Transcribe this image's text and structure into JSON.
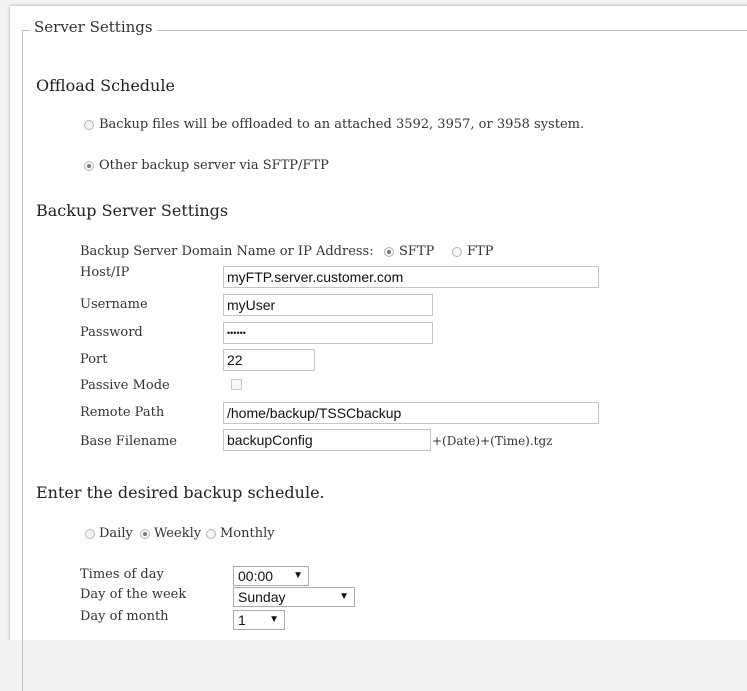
{
  "section_legend": "Server Settings",
  "offload": {
    "title": "Offload Schedule",
    "option_attached": "Backup files will be offloaded to an attached 3592, 3957, or 3958 system.",
    "option_other": "Other backup server via SFTP/FTP",
    "selected": "other"
  },
  "backup_server": {
    "title": "Backup Server Settings",
    "domain_label": "Backup Server Domain Name or IP Address:",
    "protocol_sftp": "SFTP",
    "protocol_ftp": "FTP",
    "protocol_selected": "SFTP",
    "host_label": "Host/IP",
    "host_value": "myFTP.server.customer.com",
    "username_label": "Username",
    "username_value": "myUser",
    "password_label": "Password",
    "password_value": "••••••",
    "port_label": "Port",
    "port_value": "22",
    "passive_label": "Passive Mode",
    "passive_checked": false,
    "remote_path_label": "Remote Path",
    "remote_path_value": "/home/backup/TSSCbackup",
    "base_filename_label": "Base Filename",
    "base_filename_value": "backupConfig",
    "base_filename_suffix": "+(Date)+(Time).tgz"
  },
  "schedule": {
    "title": "Enter the desired backup schedule.",
    "daily": "Daily",
    "weekly": "Weekly",
    "monthly": "Monthly",
    "frequency_selected": "Weekly",
    "times_label": "Times of day",
    "times_value": "00:00",
    "dow_label": "Day of the week",
    "dow_value": "Sunday",
    "dom_label": "Day of month",
    "dom_value": "1"
  }
}
